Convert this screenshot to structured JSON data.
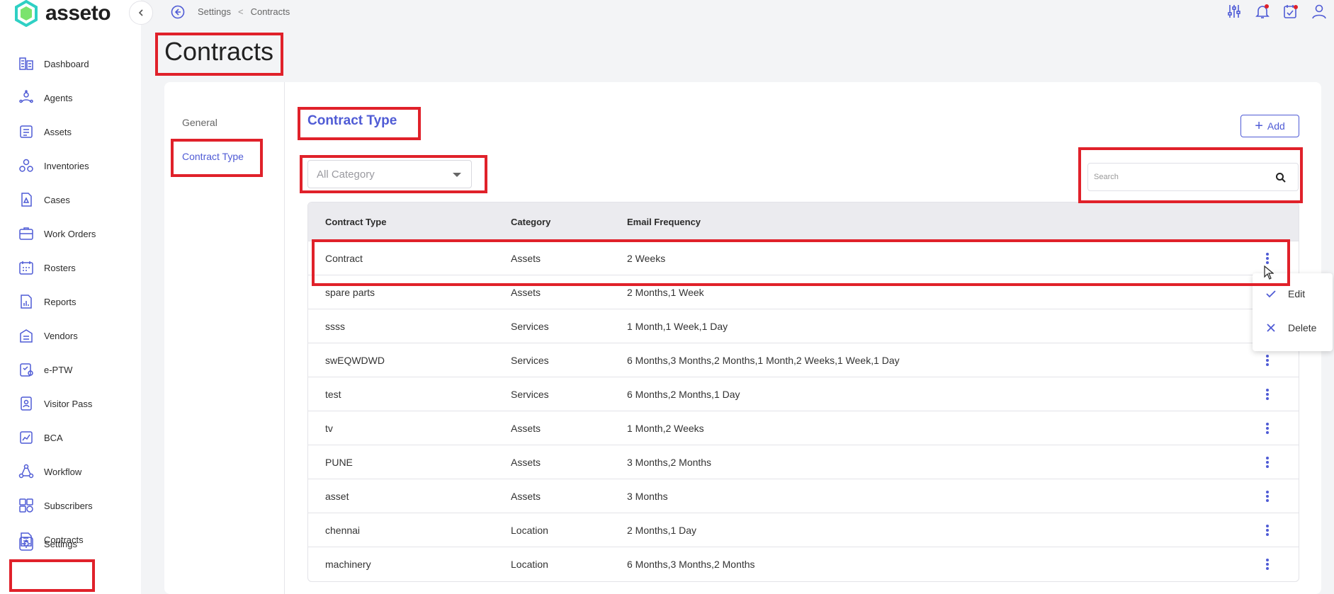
{
  "app": {
    "name": "asseto"
  },
  "sidebar": {
    "items": [
      {
        "label": "Dashboard",
        "icon": "dashboard-icon"
      },
      {
        "label": "Agents",
        "icon": "agents-icon"
      },
      {
        "label": "Assets",
        "icon": "assets-icon"
      },
      {
        "label": "Inventories",
        "icon": "inventories-icon"
      },
      {
        "label": "Cases",
        "icon": "cases-icon"
      },
      {
        "label": "Work Orders",
        "icon": "work-orders-icon"
      },
      {
        "label": "Rosters",
        "icon": "rosters-icon"
      },
      {
        "label": "Reports",
        "icon": "reports-icon"
      },
      {
        "label": "Vendors",
        "icon": "vendors-icon"
      },
      {
        "label": "e-PTW",
        "icon": "eptw-icon"
      },
      {
        "label": "Visitor Pass",
        "icon": "visitor-pass-icon"
      },
      {
        "label": "BCA",
        "icon": "bca-icon"
      },
      {
        "label": "Workflow",
        "icon": "workflow-icon"
      },
      {
        "label": "Subscribers",
        "icon": "subscribers-icon"
      },
      {
        "label": "Contracts",
        "icon": "contracts-icon"
      }
    ],
    "settings_label": "Settings"
  },
  "breadcrumb": {
    "parent": "Settings",
    "separator": "<",
    "current": "Contracts"
  },
  "page": {
    "title": "Contracts"
  },
  "tabs": {
    "general": "General",
    "contract_type": "Contract Type"
  },
  "section": {
    "title": "Contract Type",
    "add_label": "Add",
    "category_select": "All Category",
    "search_placeholder": "Search"
  },
  "table": {
    "headers": [
      "Contract Type",
      "Category",
      "Email Frequency"
    ],
    "rows": [
      [
        "Contract",
        "Assets",
        "2 Weeks"
      ],
      [
        "spare parts",
        "Assets",
        "2 Months,1 Week"
      ],
      [
        "ssss",
        "Services",
        "1 Month,1 Week,1 Day"
      ],
      [
        "swEQWDWD",
        "Services",
        "6 Months,3 Months,2 Months,1 Month,2 Weeks,1 Week,1 Day"
      ],
      [
        "test",
        "Services",
        "6 Months,2 Months,1 Day"
      ],
      [
        "tv",
        "Assets",
        "1 Month,2 Weeks"
      ],
      [
        "PUNE",
        "Assets",
        "3 Months,2 Months"
      ],
      [
        "asset",
        "Assets",
        "3 Months"
      ],
      [
        "chennai",
        "Location",
        "2 Months,1 Day"
      ],
      [
        "machinery",
        "Location",
        "6 Months,3 Months,2 Months"
      ]
    ]
  },
  "row_menu": {
    "edit": "Edit",
    "delete": "Delete"
  },
  "colors": {
    "accent": "#4f5bd5",
    "highlight": "#e0212a"
  }
}
